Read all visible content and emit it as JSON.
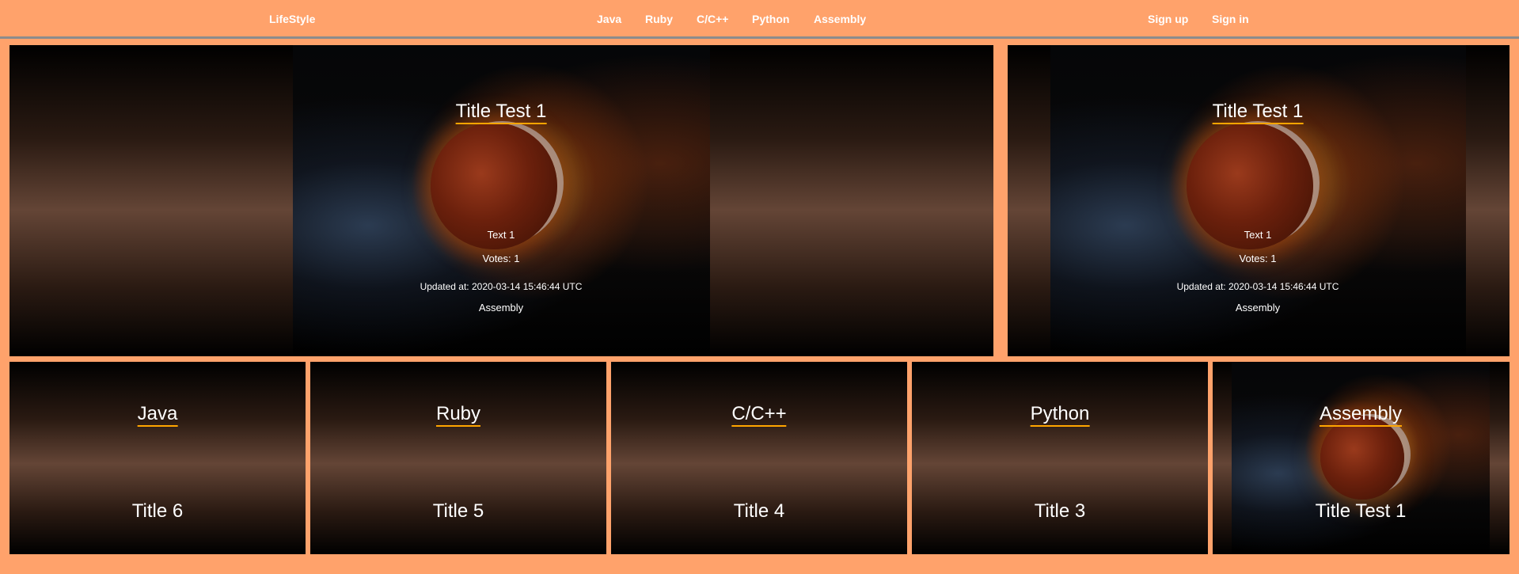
{
  "nav": {
    "brand": "LifeStyle",
    "links": [
      "Java",
      "Ruby",
      "C/C++",
      "Python",
      "Assembly"
    ],
    "signup": "Sign up",
    "signin": "Sign in"
  },
  "featured": [
    {
      "title": "Title Test 1",
      "text": "Text 1",
      "votes": "Votes: 1",
      "updated": "Updated at: 2020-03-14 15:46:44 UTC",
      "category": "Assembly"
    },
    {
      "title": "Title Test 1",
      "text": "Text 1",
      "votes": "Votes: 1",
      "updated": "Updated at: 2020-03-14 15:46:44 UTC",
      "category": "Assembly"
    }
  ],
  "categories": [
    {
      "name": "Java",
      "title": "Title 6"
    },
    {
      "name": "Ruby",
      "title": "Title 5"
    },
    {
      "name": "C/C++",
      "title": "Title 4"
    },
    {
      "name": "Python",
      "title": "Title 3"
    },
    {
      "name": "Assembly",
      "title": "Title Test 1"
    }
  ]
}
